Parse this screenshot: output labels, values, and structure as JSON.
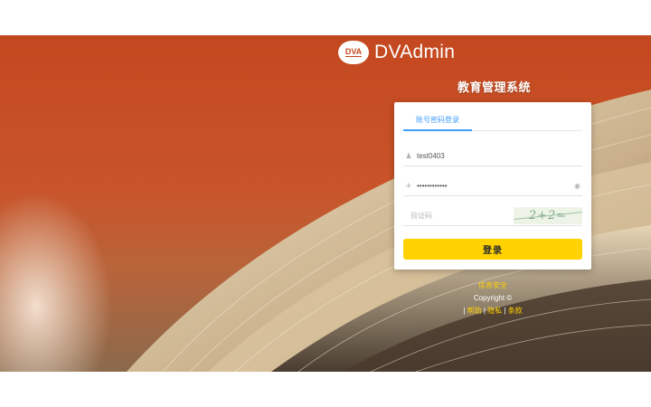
{
  "logo": {
    "badge": "DVA",
    "name": "DVAdmin"
  },
  "system_title": "教育管理系统",
  "login": {
    "tab_label": "账号密码登录",
    "username_value": "test0403",
    "password_value": "••••••••••••",
    "captcha_placeholder": "验证码",
    "captcha_text": "2+2=",
    "submit_label": "登录"
  },
  "footer": {
    "line1": "信息安全",
    "line2": "Copyright ©",
    "links": [
      "帮助",
      "隐私",
      "条款"
    ]
  },
  "colors": {
    "accent": "#409eff",
    "button": "#ffd200",
    "background": "#c4481f"
  }
}
